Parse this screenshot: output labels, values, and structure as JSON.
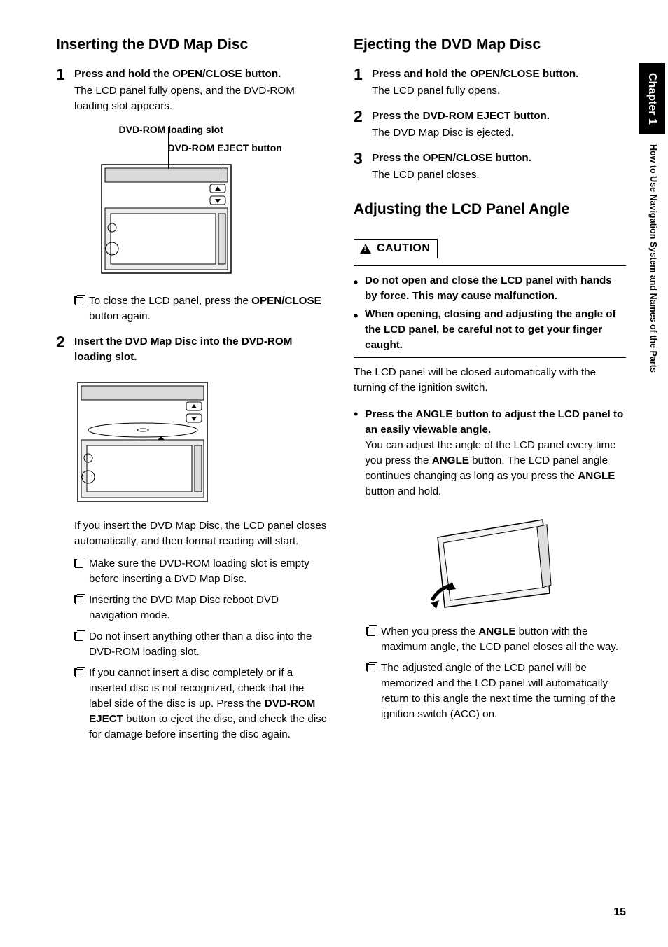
{
  "sidebar": {
    "chapter": "Chapter 1",
    "section": "How to Use Navigation System and Names of the Parts"
  },
  "page_number": "15",
  "left": {
    "heading": "Inserting the DVD Map Disc",
    "step1": {
      "num": "1",
      "lead": "Press and hold the OPEN/CLOSE button.",
      "body": "The LCD panel fully opens, and the DVD-ROM loading slot appears.",
      "callout1": "DVD-ROM loading slot",
      "callout2": "DVD-ROM EJECT button",
      "close_note_a": "To close the LCD panel, press the ",
      "close_note_b": "OPEN/CLOSE",
      "close_note_c": " button again."
    },
    "step2": {
      "num": "2",
      "lead": "Insert the DVD Map Disc into the DVD-ROM loading slot.",
      "after": "If you insert the DVD Map Disc, the LCD panel closes automatically, and then format reading will start.",
      "n1": "Make sure the DVD-ROM loading slot is empty before inserting a DVD Map Disc.",
      "n2": "Inserting the DVD Map Disc reboot DVD navigation mode.",
      "n3": "Do not insert anything other than a disc into the DVD-ROM loading slot.",
      "n4_a": "If you cannot insert a disc completely or if a inserted disc is not recognized, check that the label side of the disc is up. Press the ",
      "n4_b": "DVD-ROM EJECT",
      "n4_c": " button to eject the disc, and check the disc for damage before inserting the disc again."
    }
  },
  "right": {
    "heading1": "Ejecting the DVD Map Disc",
    "e1": {
      "num": "1",
      "lead": "Press and hold the OPEN/CLOSE button.",
      "body": "The LCD panel fully opens."
    },
    "e2": {
      "num": "2",
      "lead": "Press the DVD-ROM EJECT button.",
      "body": "The DVD Map Disc is ejected."
    },
    "e3": {
      "num": "3",
      "lead": "Press the OPEN/CLOSE button.",
      "body": "The LCD panel closes."
    },
    "heading2": "Adjusting the LCD Panel Angle",
    "caution_label": "CAUTION",
    "caution_items": {
      "c1": "Do not open and close the LCD panel with hands by force. This may cause malfunction.",
      "c2": "When opening, closing and adjusting the angle of the LCD panel, be careful not to get your finger caught."
    },
    "auto_close": "The LCD panel will be closed automatically with the turning of the ignition switch.",
    "angle": {
      "lead": "Press the ANGLE button to adjust the LCD panel to an easily viewable angle.",
      "body_a": "You can adjust the angle of the LCD panel every time you press the ",
      "body_b": "ANGLE",
      "body_c": " button. The LCD panel angle continues changing as long as you press the ",
      "body_d": "ANGLE",
      "body_e": " button and hold."
    },
    "angle_notes": {
      "a1_a": "When you press the ",
      "a1_b": "ANGLE",
      "a1_c": " button with the maximum angle, the LCD panel closes all the way.",
      "a2": "The adjusted angle of the LCD panel will be memorized and the LCD panel will automatically return to this angle the next time the turning of the ignition switch (ACC) on."
    }
  }
}
